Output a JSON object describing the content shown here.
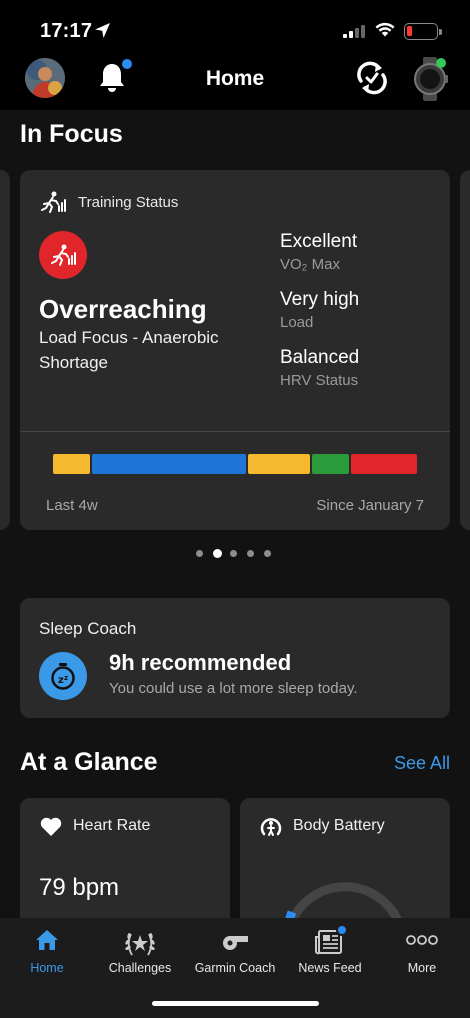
{
  "status_bar": {
    "time": "17:17"
  },
  "nav": {
    "title": "Home"
  },
  "in_focus": {
    "section_title": "In Focus",
    "training_status": {
      "header": "Training Status",
      "status": "Overreaching",
      "load_focus": "Load Focus - Anaerobic Shortage",
      "metrics": [
        {
          "value": "Excellent",
          "label": "VO₂ Max"
        },
        {
          "value": "Very high",
          "label": "Load"
        },
        {
          "value": "Balanced",
          "label": "HRV Status"
        }
      ],
      "timeline": {
        "start_label": "Last 4w",
        "end_label": "Since January 7",
        "segments": [
          {
            "color": "#f5b82e",
            "fraction": 0.1
          },
          {
            "color": "#1f74d6",
            "fraction": 0.42
          },
          {
            "color": "#f5b82e",
            "fraction": 0.17
          },
          {
            "color": "#2a9a3a",
            "fraction": 0.1
          },
          {
            "color": "#e0262a",
            "fraction": 0.18
          }
        ]
      }
    },
    "pager": {
      "count": 5,
      "active_index": 1
    }
  },
  "sleep_coach": {
    "title": "Sleep Coach",
    "headline": "9h  recommended",
    "message": "You could use a lot more sleep today."
  },
  "at_a_glance": {
    "section_title": "At a Glance",
    "see_all": "See All",
    "heart_rate": {
      "label": "Heart Rate",
      "value": "79 bpm"
    },
    "body_battery": {
      "label": "Body Battery"
    }
  },
  "tab_bar": {
    "tabs": [
      {
        "label": "Home",
        "icon": "home-icon",
        "active": true
      },
      {
        "label": "Challenges",
        "icon": "laurel-icon",
        "active": false
      },
      {
        "label": "Garmin Coach",
        "icon": "whistle-icon",
        "active": false
      },
      {
        "label": "News Feed",
        "icon": "newspaper-icon",
        "active": false
      },
      {
        "label": "More",
        "icon": "more-icon",
        "active": false
      }
    ]
  },
  "colors": {
    "accent": "#3b9ae8",
    "status_red": "#e0262a",
    "notification_dot": "#2b8cf2",
    "watch_connected": "#34c759"
  }
}
